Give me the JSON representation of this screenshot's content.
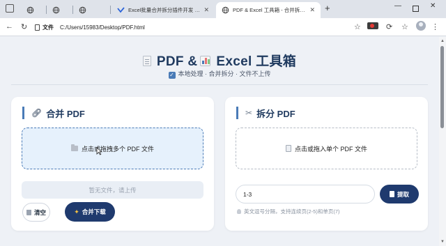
{
  "browser": {
    "tabs": [
      {
        "title": "",
        "favicon": "globe-icon",
        "active": false
      },
      {
        "title": "",
        "favicon": "globe-icon",
        "active": false
      },
      {
        "title": "",
        "favicon": "globe-icon",
        "active": false
      },
      {
        "title": "Excel批量合并拆分插件开发 - Desk",
        "favicon": "brand-icon",
        "active": false
      },
      {
        "title": "PDF & Excel 工具箱 - 合并拆分 ·",
        "favicon": "globe-icon",
        "active": true
      }
    ],
    "url_scheme": "文件",
    "url": "C:/Users/15983/Desktop/PDF.html"
  },
  "hero": {
    "title_a": "PDF &",
    "title_b": "Excel 工具箱",
    "subtitle": "本地处理 · 合并拆分 · 文件不上传"
  },
  "merge": {
    "heading": "合并 PDF",
    "drop_text": "点击或拖拽多个 PDF 文件",
    "empty_text": "暂无文件，请上传",
    "clear_label": "清空",
    "merge_label": "合并下载"
  },
  "split": {
    "heading": "拆分 PDF",
    "drop_text": "点击或拖入单个 PDF 文件",
    "range_value": "1-3",
    "extract_label": "提取",
    "hint": "英文逗号分隔，支持连续页(2-5)和单页(7)"
  },
  "colors": {
    "accent": "#4a7bb7",
    "primary_button": "#1f3a6e",
    "title": "#1f3a5f"
  }
}
